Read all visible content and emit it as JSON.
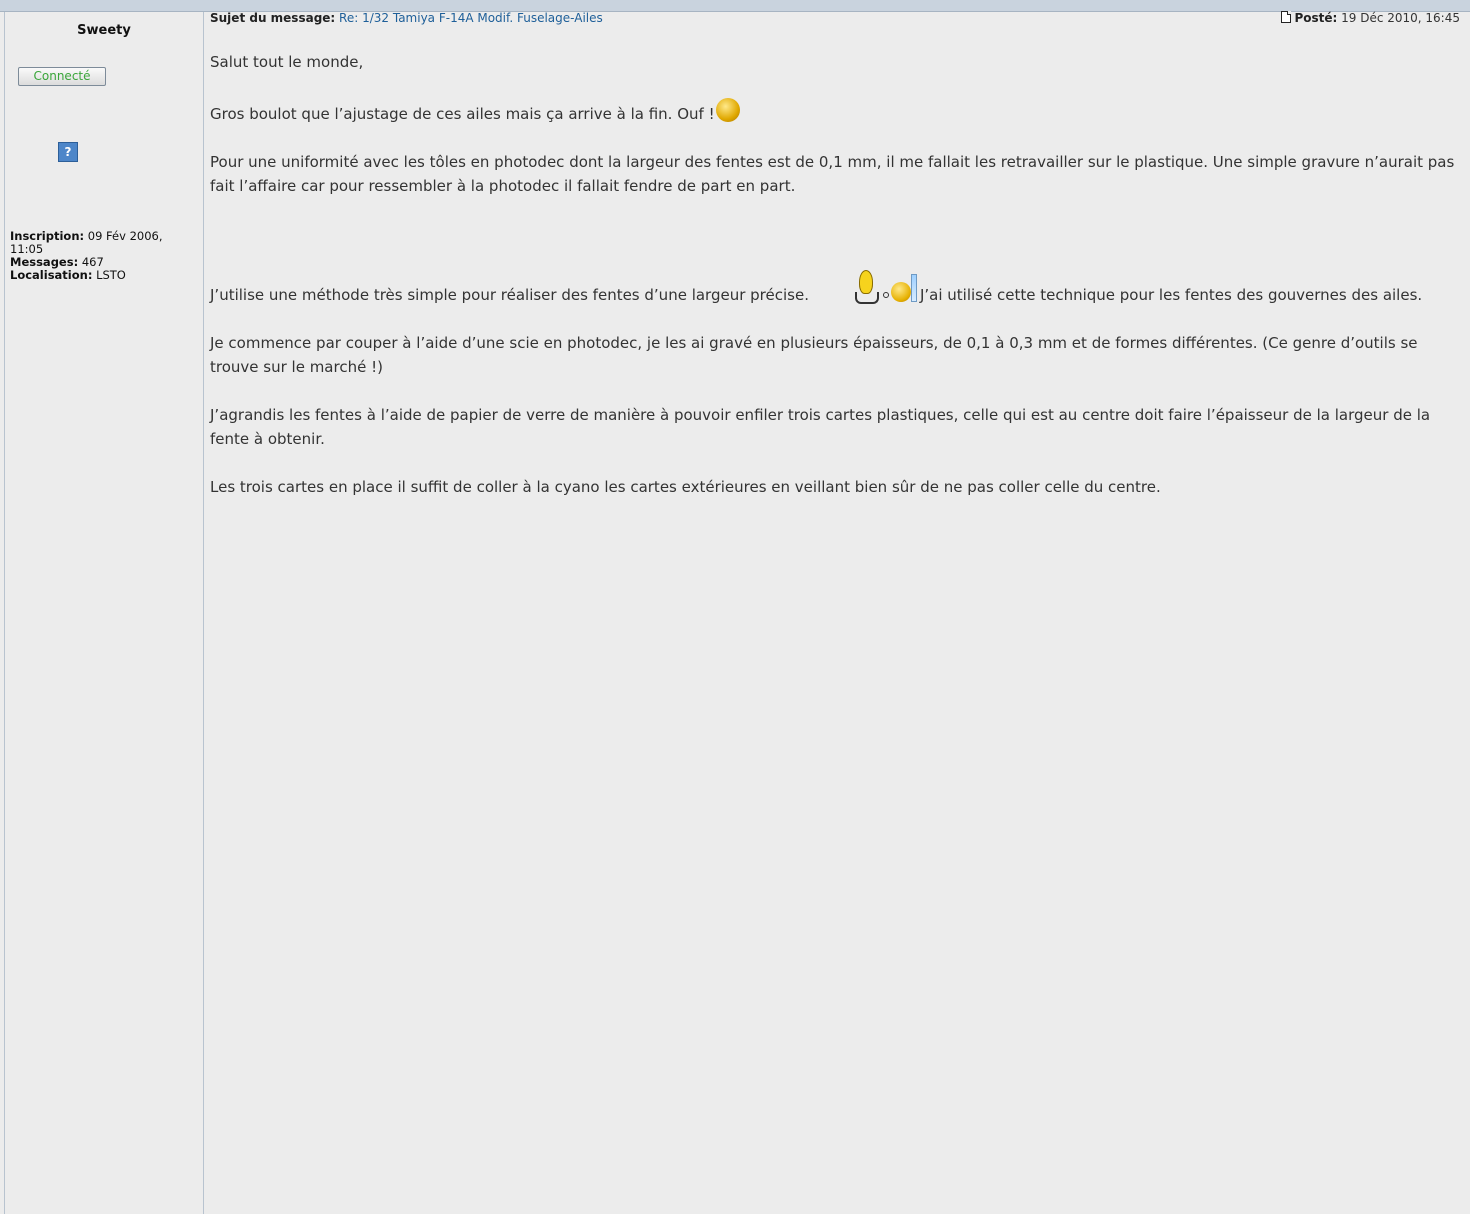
{
  "post": {
    "author": "Sweety",
    "status_badge": "Connecté",
    "avatar_placeholder": "?",
    "profile": {
      "inscription_label": "Inscription:",
      "inscription_value": "09 Fév 2006, 11:05",
      "messages_label": "Messages:",
      "messages_value": "467",
      "location_label": "Localisation:",
      "location_value": "LSTO"
    },
    "subject_label": "Sujet du message:",
    "subject": "Re: 1/32 Tamiya F-14A Modif. Fuselage-Ailes",
    "posted_label": "Posté:",
    "posted_date": "19 Déc 2010, 16:45",
    "body": {
      "p1": "Salut tout le monde,",
      "p2": "Gros boulot que l’ajustage de ces ailes mais ça arrive à la fin. Ouf !",
      "p3": "Pour une uniformité avec les tôles en photodec dont la largeur des fentes est de 0,1 mm, il me fallait les retravailler sur le plastique. Une simple gravure n’aurait pas fait l’affaire car pour ressembler à la photodec il fallait fendre de part en part.",
      "p4a": "J’utilise une méthode très simple pour réaliser des fentes d’une largeur précise.",
      "p4b": "J’ai utilisé cette technique pour les fentes des gouvernes des ailes.",
      "p5": "Je commence par couper à l’aide d’une scie en photodec, je les ai gravé en plusieurs épaisseurs, de 0,1 à 0,3 mm et de formes différentes. (Ce genre d’outils se trouve sur le marché !)",
      "p6": "J’agrandis les fentes à l’aide de papier de verre de manière à pouvoir enfiler trois cartes plastiques, celle qui est au centre doit faire l’épaisseur de la largeur de la fente à obtenir.",
      "p7": "Les trois cartes en place il suffit de coller à la cyano les cartes extérieures en veillant bien sûr de ne pas coller celle du centre."
    }
  }
}
